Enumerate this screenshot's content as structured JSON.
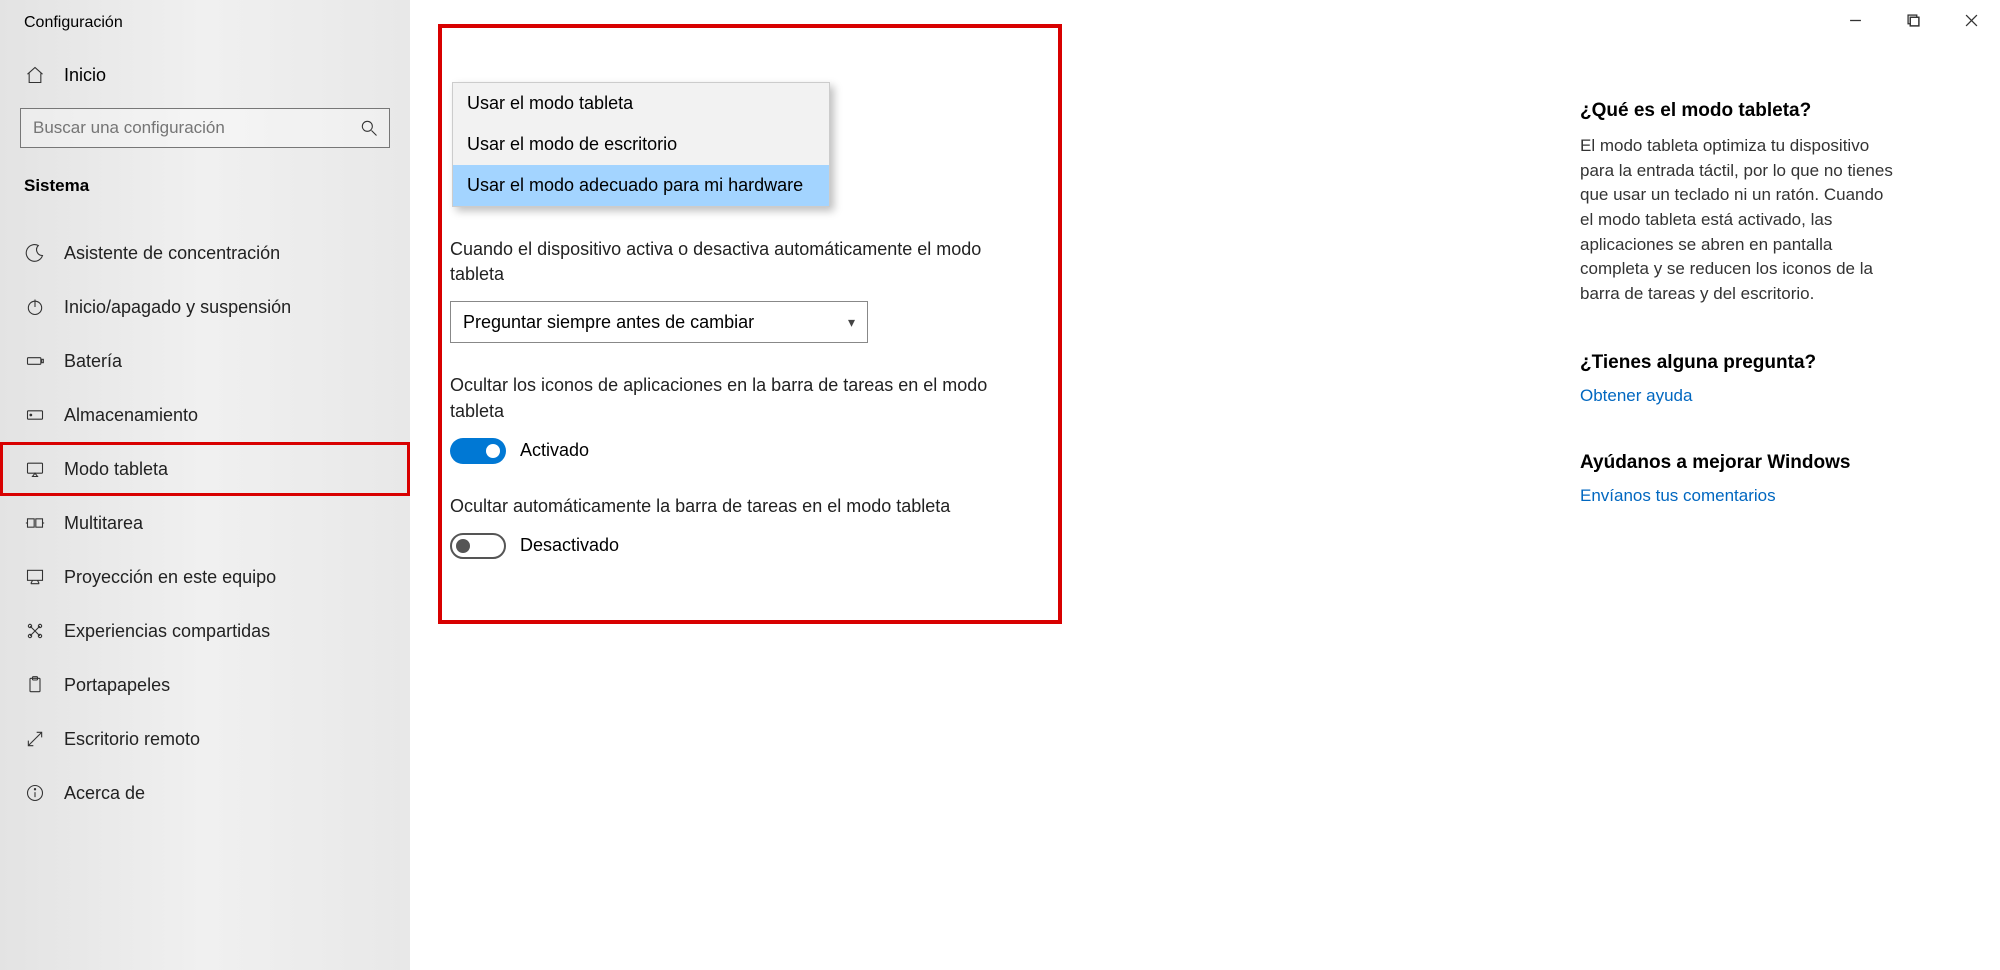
{
  "window_title": "Configuración",
  "home_label": "Inicio",
  "search_placeholder": "Buscar una configuración",
  "section": "Sistema",
  "nav": [
    {
      "label": "Asistente de concentración"
    },
    {
      "label": "Inicio/apagado y suspensión"
    },
    {
      "label": "Batería"
    },
    {
      "label": "Almacenamiento"
    },
    {
      "label": "Modo tableta"
    },
    {
      "label": "Multitarea"
    },
    {
      "label": "Proyección en este equipo"
    },
    {
      "label": "Experiencias compartidas"
    },
    {
      "label": "Portapapeles"
    },
    {
      "label": "Escritorio remoto"
    },
    {
      "label": "Acerca de"
    }
  ],
  "dropdown_options": {
    "opt0": "Usar el modo tableta",
    "opt1": "Usar el modo de escritorio",
    "opt2": "Usar el modo adecuado para mi hardware"
  },
  "setting_switch_label": "Cuando el dispositivo activa o desactiva automáticamente el modo tableta",
  "setting_switch_value": "Preguntar siempre antes de cambiar",
  "toggle1_label": "Ocultar los iconos de aplicaciones en la barra de tareas en el modo tableta",
  "toggle1_state": "Activado",
  "toggle2_label": "Ocultar automáticamente la barra de tareas en el modo tableta",
  "toggle2_state": "Desactivado",
  "aside": {
    "q1_title": "¿Qué es el modo tableta?",
    "q1_body": "El modo tableta optimiza tu dispositivo para la entrada táctil, por lo que no tienes que usar un teclado ni un ratón. Cuando el modo tableta está activado, las aplicaciones se abren en pantalla completa y se reducen los iconos de la barra de tareas y del escritorio.",
    "q2_title": "¿Tienes alguna pregunta?",
    "q2_link": "Obtener ayuda",
    "q3_title": "Ayúdanos a mejorar Windows",
    "q3_link": "Envíanos tus comentarios"
  }
}
